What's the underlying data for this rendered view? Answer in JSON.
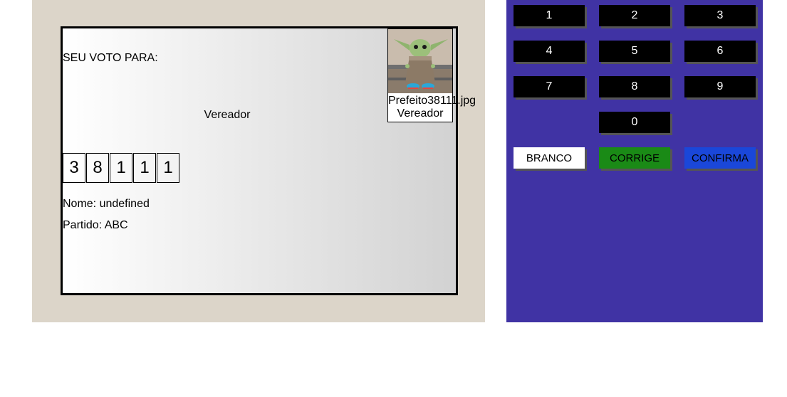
{
  "screen": {
    "vote_title": "SEU VOTO PARA:",
    "office": "Vereador",
    "digits": [
      "3",
      "8",
      "1",
      "1",
      "1"
    ],
    "name_line": "Nome: undefined",
    "party_line": "Partido: ABC",
    "photo": {
      "caption": "Prefeito38111.jpg",
      "subtitle": "Vereador"
    }
  },
  "keypad": {
    "keys": [
      "1",
      "2",
      "3",
      "4",
      "5",
      "6",
      "7",
      "8",
      "9",
      "0"
    ],
    "branco_label": "BRANCO",
    "corrige_label": "CORRIGE",
    "confirma_label": "CONFIRMA"
  },
  "colors": {
    "screen_panel_bg": "#dcd5c9",
    "keypad_bg": "#4033a4",
    "corrige": "#1a8a16",
    "confirma": "#1a47d9"
  }
}
